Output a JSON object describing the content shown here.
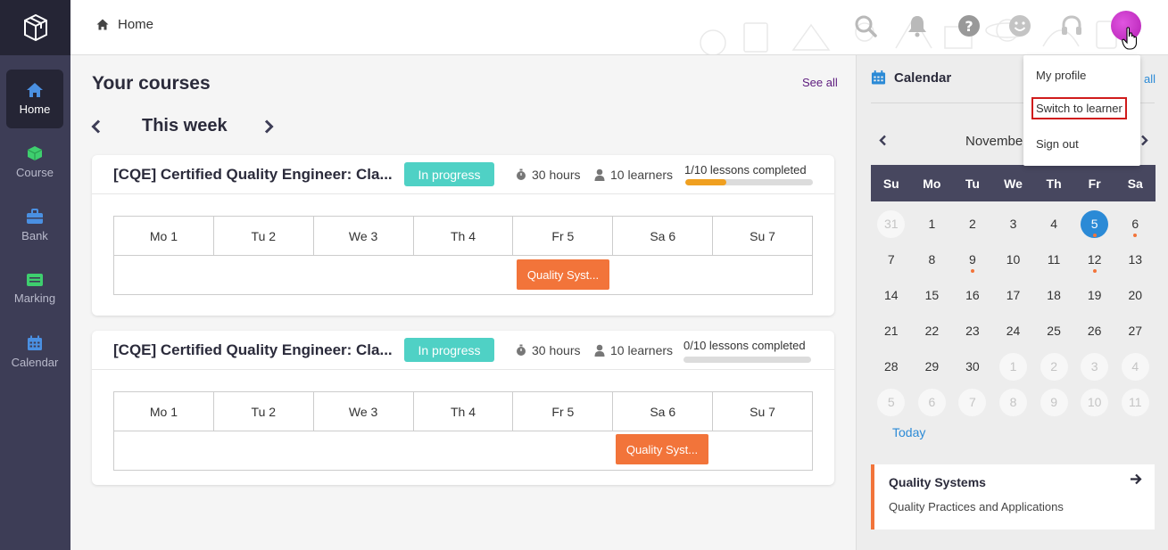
{
  "header": {
    "breadcrumb": "Home",
    "icons": [
      "search-icon",
      "bell-icon",
      "help-icon",
      "smiley-icon",
      "headset-icon"
    ]
  },
  "sidebar": {
    "items": [
      {
        "label": "Home",
        "icon": "home-icon",
        "active": true
      },
      {
        "label": "Course",
        "icon": "cube-icon"
      },
      {
        "label": "Bank",
        "icon": "briefcase-icon"
      },
      {
        "label": "Marking",
        "icon": "marking-icon"
      },
      {
        "label": "Calendar",
        "icon": "calendar-icon"
      }
    ]
  },
  "main": {
    "title": "Your courses",
    "see_all": "See all",
    "week_label": "This week",
    "courses": [
      {
        "title": "[CQE] Certified Quality Engineer: Cla...",
        "status": "In progress",
        "hours": "30 hours",
        "learners": "10 learners",
        "lessons": "1/10 lessons completed",
        "progress": 0.32,
        "days": [
          "Mo 1",
          "Tu 2",
          "We 3",
          "Th 4",
          "Fr 5",
          "Sa 6",
          "Su 7"
        ],
        "event": "Quality Syst...",
        "event_day_index": 4
      },
      {
        "title": "[CQE] Certified Quality Engineer: Cla...",
        "status": "In progress",
        "hours": "30 hours",
        "learners": "10 learners",
        "lessons": "0/10 lessons completed",
        "progress": 0,
        "days": [
          "Mo 1",
          "Tu 2",
          "We 3",
          "Th 4",
          "Fr 5",
          "Sa 6",
          "Su 7"
        ],
        "event": "Quality Syst...",
        "event_day_index": 5
      }
    ]
  },
  "calendar": {
    "title": "Calendar",
    "see_all_partial": "all",
    "month": "November",
    "dow": [
      "Su",
      "Mo",
      "Tu",
      "We",
      "Th",
      "Fr",
      "Sa"
    ],
    "weeks": [
      [
        "31",
        "1",
        "2",
        "3",
        "4",
        "5",
        "6"
      ],
      [
        "7",
        "8",
        "9",
        "10",
        "11",
        "12",
        "13"
      ],
      [
        "14",
        "15",
        "16",
        "17",
        "18",
        "19",
        "20"
      ],
      [
        "21",
        "22",
        "23",
        "24",
        "25",
        "26",
        "27"
      ],
      [
        "28",
        "29",
        "30",
        "1",
        "2",
        "3",
        "4"
      ],
      [
        "5",
        "6",
        "7",
        "8",
        "9",
        "10",
        "11"
      ]
    ],
    "today_link": "Today",
    "event": {
      "title": "Quality Systems",
      "subtitle": "Quality Practices and Applications"
    }
  },
  "dropdown": {
    "items": [
      "My profile",
      "Switch to learner",
      "Sign out"
    ]
  },
  "colors": {
    "sidebar": "#3d3d56",
    "sidebar_active": "#252535",
    "accent_teal": "#4fd1c5",
    "accent_orange": "#f2743a",
    "progress": "#f0a020",
    "link_blue": "#2b8ad6",
    "highlight_red": "#d01c1c"
  }
}
